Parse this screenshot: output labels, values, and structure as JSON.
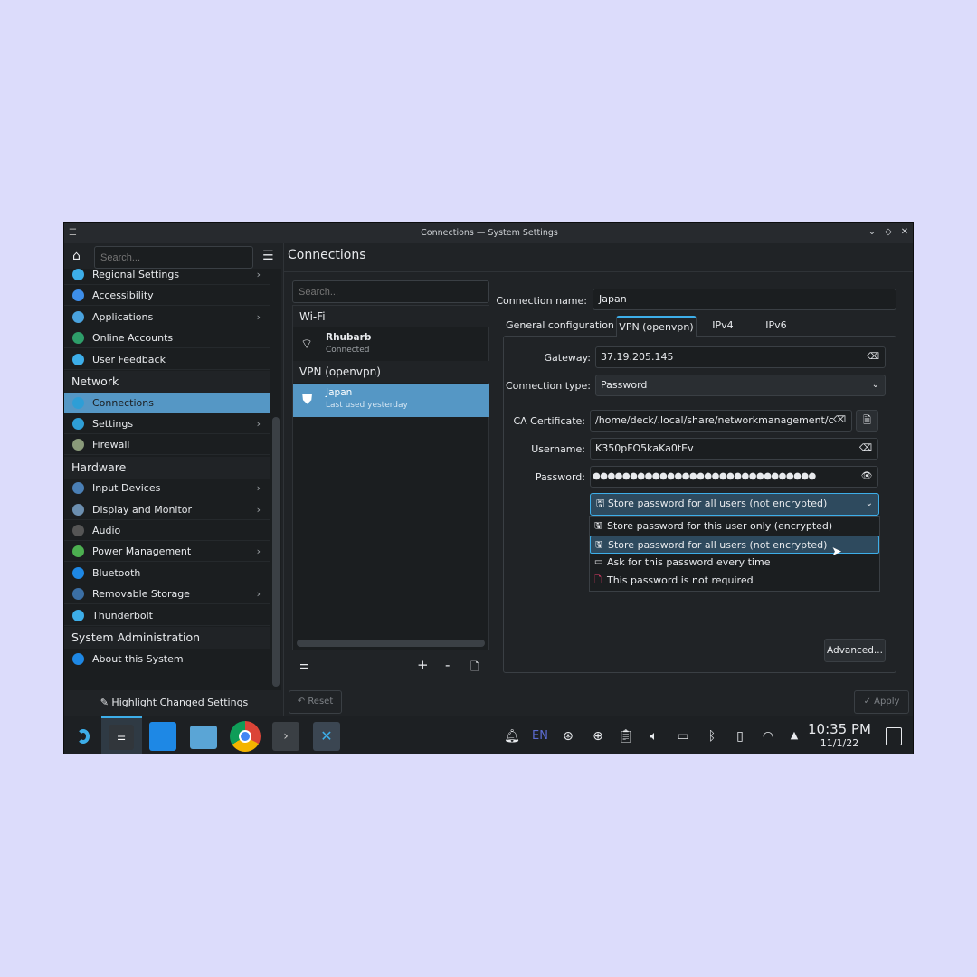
{
  "window": {
    "title": "Connections — System Settings",
    "controls": [
      "minimize",
      "maximize",
      "close"
    ]
  },
  "sidebar": {
    "search_placeholder": "Search...",
    "items": [
      {
        "label": "Regional Settings",
        "chevron": true,
        "color": "#3daee9"
      },
      {
        "label": "Accessibility",
        "chevron": false,
        "color": "#3d8ee9"
      },
      {
        "label": "Applications",
        "chevron": true,
        "color": "#4aa3df"
      },
      {
        "label": "Online Accounts",
        "chevron": false,
        "color": "#2e9e6a"
      },
      {
        "label": "User Feedback",
        "chevron": false,
        "color": "#3daee9"
      }
    ],
    "network_header": "Network",
    "network_items": [
      {
        "label": "Connections",
        "chevron": false,
        "selected": true
      },
      {
        "label": "Settings",
        "chevron": true
      },
      {
        "label": "Firewall",
        "chevron": false
      }
    ],
    "hardware_header": "Hardware",
    "hardware_items": [
      {
        "label": "Input Devices",
        "chevron": true
      },
      {
        "label": "Display and Monitor",
        "chevron": true
      },
      {
        "label": "Audio",
        "chevron": false
      },
      {
        "label": "Power Management",
        "chevron": true
      },
      {
        "label": "Bluetooth",
        "chevron": false
      },
      {
        "label": "Removable Storage",
        "chevron": true
      },
      {
        "label": "Thunderbolt",
        "chevron": false
      }
    ],
    "sysadmin_header": "System Administration",
    "sysadmin_items": [
      {
        "label": "About this System"
      }
    ],
    "highlight_label": "Highlight Changed Settings"
  },
  "page_title": "Connections",
  "connections": {
    "search_placeholder": "Search...",
    "wifi_header": "Wi-Fi",
    "wifi": {
      "name": "Rhubarb",
      "status": "Connected"
    },
    "vpn_header": "VPN (openvpn)",
    "vpn": {
      "name": "Japan",
      "status": "Last used yesterday"
    },
    "toolbar": {
      "add": "+",
      "remove": "-"
    }
  },
  "details": {
    "name_label": "Connection name:",
    "name_value": "Japan",
    "tabs": [
      "General configuration",
      "VPN (openvpn)",
      "IPv4",
      "IPv6"
    ],
    "active_tab": 1,
    "gateway_label": "Gateway:",
    "gateway": "37.19.205.145",
    "conn_type_label": "Connection type:",
    "conn_type": "Password",
    "ca_label": "CA Certificate:",
    "ca_value": "/home/deck/.local/share/networkmanagement/cer",
    "user_label": "Username:",
    "username": "K350pFO5kaKa0tEv",
    "pass_label": "Password:",
    "password_mask": "●●●●●●●●●●●●●●●●●●●●●●●●●●●●●●",
    "store_selected": "Store password for all users (not encrypted)",
    "store_options": [
      "Store password for this user only (encrypted)",
      "Store password for all users (not encrypted)",
      "Ask for this password every time",
      "This password is not required"
    ],
    "advanced": "Advanced..."
  },
  "footer": {
    "reset": "Reset",
    "apply": "Apply"
  },
  "taskbar": {
    "lang": "EN",
    "time": "10:35 PM",
    "date": "11/1/22"
  }
}
